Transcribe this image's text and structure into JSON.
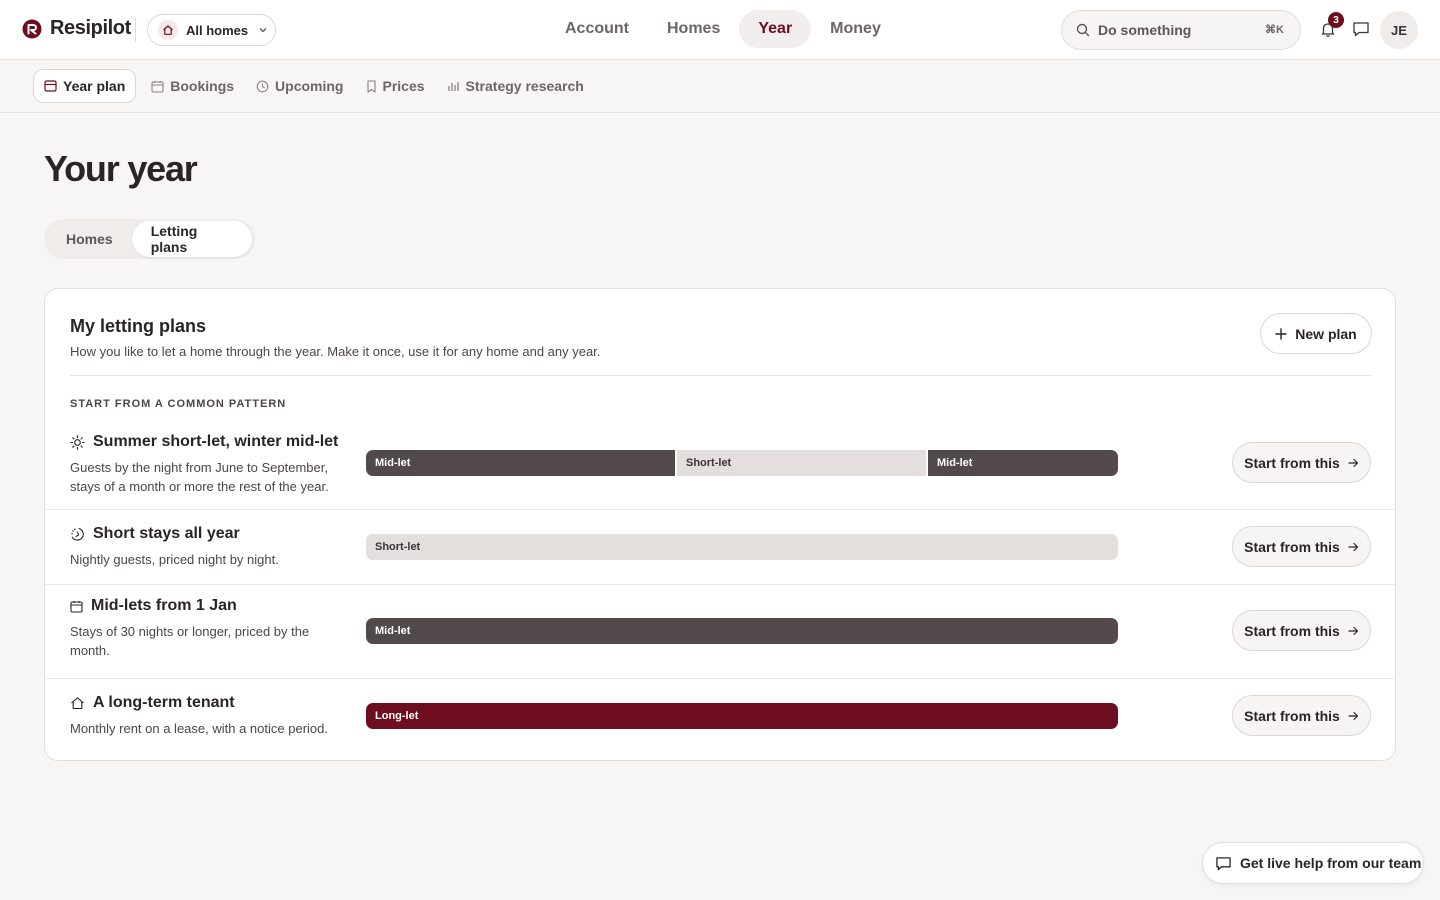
{
  "app": {
    "brand": "Resipilot"
  },
  "colors": {
    "accent": "#6e0d1f",
    "midlet": "#524a4a",
    "shortlet": "#e4dfdd",
    "longlet": "#6e0d1f"
  },
  "header": {
    "home_picker": "All homes",
    "nav": [
      {
        "label": "Account",
        "active": false
      },
      {
        "label": "Homes",
        "active": false
      },
      {
        "label": "Year",
        "active": true
      },
      {
        "label": "Money",
        "active": false
      }
    ],
    "search": {
      "placeholder": "Do something",
      "shortcut": "⌘K"
    },
    "notifications_count": "3",
    "avatar_initials": "JE"
  },
  "subnav": [
    {
      "label": "Year plan",
      "icon": "layout-icon",
      "active": true
    },
    {
      "label": "Bookings",
      "icon": "calendar-icon",
      "active": false
    },
    {
      "label": "Upcoming",
      "icon": "clock-icon",
      "active": false
    },
    {
      "label": "Prices",
      "icon": "bookmark-icon",
      "active": false
    },
    {
      "label": "Strategy research",
      "icon": "bar-chart-icon",
      "active": false
    }
  ],
  "page": {
    "title": "Your year",
    "segments": [
      {
        "label": "Homes",
        "active": false
      },
      {
        "label": "Letting plans",
        "active": true
      }
    ]
  },
  "card": {
    "title": "My letting plans",
    "subtitle": "How you like to let a home through the year. Make it once, use it for any home and any year.",
    "new_plan_label": "New plan",
    "section_label": "START FROM A COMMON PATTERN",
    "start_label": "Start from this",
    "patterns": [
      {
        "icon": "sun-icon",
        "title": "Summer short-let, winter mid-let",
        "description": "Guests by the night from June to September, stays of a month or more the rest of the year.",
        "segments": [
          {
            "label": "Mid-let",
            "kind": "midlet",
            "share": 0.413
          },
          {
            "label": "Short-let",
            "kind": "shortlet",
            "share": 0.333
          },
          {
            "label": "Mid-let",
            "kind": "midlet",
            "share": 0.254
          }
        ]
      },
      {
        "icon": "moon-icon",
        "title": "Short stays all year",
        "description": "Nightly guests, priced night by night.",
        "segments": [
          {
            "label": "Short-let",
            "kind": "shortlet",
            "share": 1
          }
        ]
      },
      {
        "icon": "calendar-icon",
        "title": "Mid-lets from 1 Jan",
        "description": "Stays of 30 nights or longer, priced by the month.",
        "segments": [
          {
            "label": "Mid-let",
            "kind": "midlet",
            "share": 1
          }
        ]
      },
      {
        "icon": "home-icon",
        "title": "A long-term tenant",
        "description": "Monthly rent on a lease, with a notice period.",
        "segments": [
          {
            "label": "Long-let",
            "kind": "longlet",
            "share": 1
          }
        ]
      }
    ]
  },
  "help_button": "Get live help from our team"
}
